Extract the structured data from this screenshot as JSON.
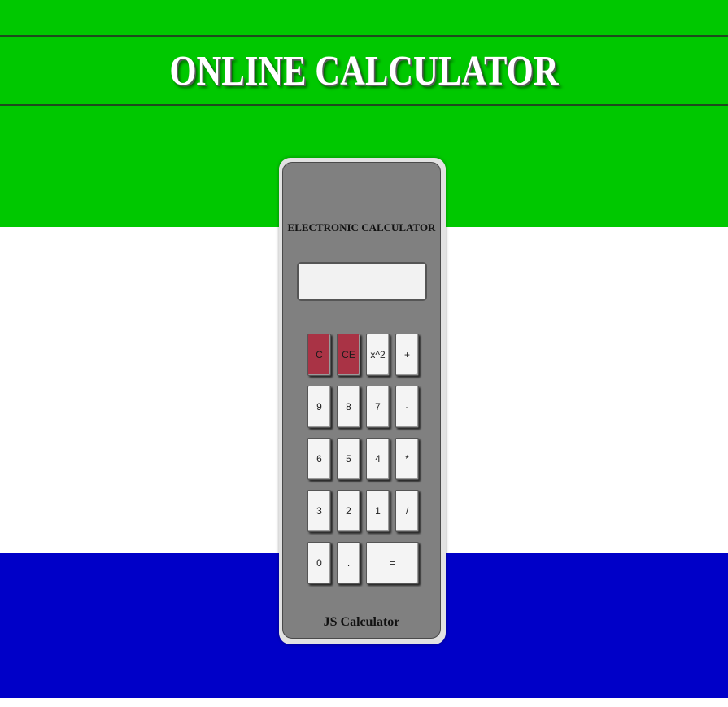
{
  "header": {
    "title": "ONLINE CALCULATOR"
  },
  "calculator": {
    "brand": "ELECTRONIC CALCULATOR",
    "display_value": "",
    "footer": "JS Calculator",
    "buttons": {
      "clear": "C",
      "clear_entry": "CE",
      "square": "x^2",
      "plus": "+",
      "nine": "9",
      "eight": "8",
      "seven": "7",
      "minus": "-",
      "six": "6",
      "five": "5",
      "four": "4",
      "multiply": "*",
      "three": "3",
      "two": "2",
      "one": "1",
      "divide": "/",
      "zero": "0",
      "decimal": ".",
      "equals": "="
    }
  },
  "colors": {
    "green_band": "#00c800",
    "white_band": "#ffffff",
    "blue_band": "#0000c8",
    "calculator_body": "#808080",
    "clear_button": "#a93345"
  }
}
